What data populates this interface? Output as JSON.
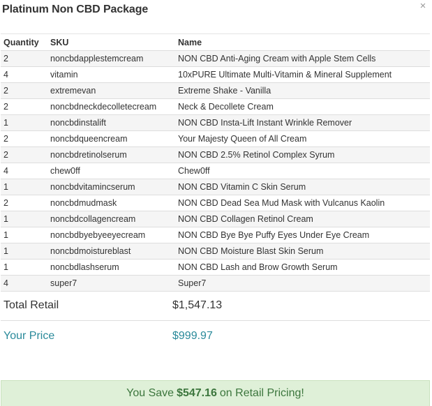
{
  "modal": {
    "title": "Platinum Non CBD Package",
    "close_glyph": "×"
  },
  "table": {
    "headers": {
      "quantity": "Quantity",
      "sku": "SKU",
      "name": "Name"
    },
    "rows": [
      {
        "qty": "2",
        "sku": "noncbdapplestemcream",
        "name": "NON CBD Anti-Aging Cream with Apple Stem Cells"
      },
      {
        "qty": "4",
        "sku": "vitamin",
        "name": "10xPURE Ultimate Multi-Vitamin & Mineral Supplement"
      },
      {
        "qty": "2",
        "sku": "extremevan",
        "name": "Extreme Shake - Vanilla"
      },
      {
        "qty": "2",
        "sku": "noncbdneckdecolletecream",
        "name": "Neck & Decollete Cream"
      },
      {
        "qty": "1",
        "sku": "noncbdinstalift",
        "name": "NON CBD Insta-Lift Instant Wrinkle Remover"
      },
      {
        "qty": "2",
        "sku": "noncbdqueencream",
        "name": "Your Majesty Queen of All Cream"
      },
      {
        "qty": "2",
        "sku": "noncbdretinolserum",
        "name": "NON CBD 2.5% Retinol Complex Syrum"
      },
      {
        "qty": "4",
        "sku": "chew0ff",
        "name": "Chew0ff"
      },
      {
        "qty": "1",
        "sku": "noncbdvitamincserum",
        "name": "NON CBD Vitamin C Skin Serum"
      },
      {
        "qty": "2",
        "sku": "noncbdmudmask",
        "name": "NON CBD Dead Sea Mud Mask with Vulcanus Kaolin"
      },
      {
        "qty": "1",
        "sku": "noncbdcollagencream",
        "name": "NON CBD Collagen Retinol Cream"
      },
      {
        "qty": "1",
        "sku": "noncbdbyebyeeyecream",
        "name": "NON CBD Bye Bye Puffy Eyes Under Eye Cream"
      },
      {
        "qty": "1",
        "sku": "noncbdmoistureblast",
        "name": "NON CBD Moisture Blast Skin Serum"
      },
      {
        "qty": "1",
        "sku": "noncbdlashserum",
        "name": "NON CBD Lash and Brow Growth Serum"
      },
      {
        "qty": "4",
        "sku": "super7",
        "name": "Super7"
      }
    ]
  },
  "summary": {
    "retail_label": "Total Retail",
    "retail_value": "$1,547.13",
    "price_label": "Your Price",
    "price_value": "$999.97"
  },
  "savings": {
    "prefix": "You Save",
    "amount": "$547.16",
    "suffix": "on Retail Pricing!"
  },
  "colors": {
    "price_accent": "#2a8a9a",
    "savings_bg": "#dff0d8",
    "savings_text": "#3c763d"
  }
}
